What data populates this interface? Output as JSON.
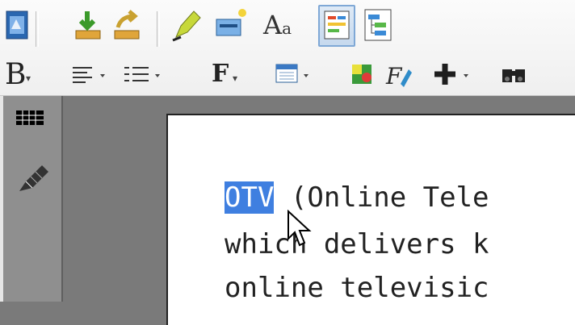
{
  "toolbar": {
    "row1": [
      {
        "name": "document-icon"
      },
      {
        "name": "import-icon"
      },
      {
        "name": "export-icon"
      },
      {
        "name": "highlighter-icon"
      },
      {
        "name": "new-note-icon"
      },
      {
        "name": "font-size-icon",
        "label": "A",
        "sub": "a"
      },
      {
        "name": "page-view-icon",
        "pressed": true
      },
      {
        "name": "outline-view-icon"
      }
    ],
    "row2": [
      {
        "name": "bold-icon",
        "label": "B"
      },
      {
        "name": "align-icon"
      },
      {
        "name": "list-icon"
      },
      {
        "name": "font-icon",
        "label": "F"
      },
      {
        "name": "calendar-icon"
      },
      {
        "name": "color-icon"
      },
      {
        "name": "format-icon"
      },
      {
        "name": "add-icon"
      },
      {
        "name": "find-icon"
      }
    ]
  },
  "document": {
    "line1_selected": "OTV",
    "line1_rest": " (Online Tele",
    "line2": "which delivers k",
    "line3": "online televisic"
  },
  "colors": {
    "selection": "#3f7fe0",
    "canvas": "#7a7a7a",
    "panel": "#8f8f8f"
  }
}
